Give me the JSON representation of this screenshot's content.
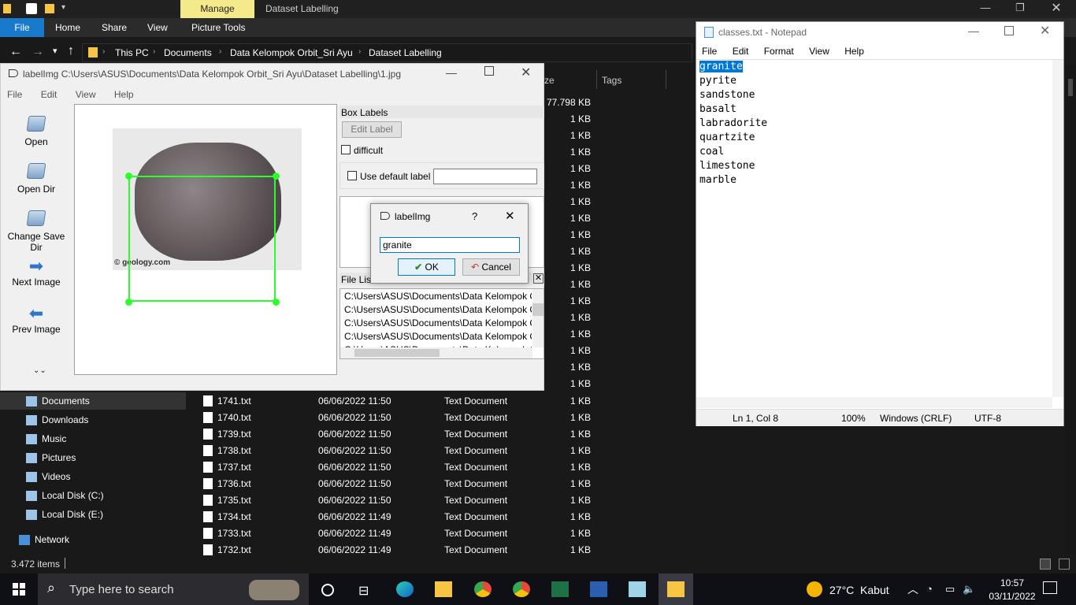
{
  "explorer": {
    "title": "Dataset Labelling",
    "manage_tab": "Manage",
    "ribbon_tabs": [
      "File",
      "Home",
      "Share",
      "View",
      "Picture Tools"
    ],
    "breadcrumb": [
      "This PC",
      "Documents",
      "Data Kelompok Orbit_Sri Ayu",
      "Dataset Labelling"
    ],
    "col_size_header": "ze",
    "col_tags_header": "Tags",
    "top_sizes": [
      "77.798 KB",
      "1 KB",
      "1 KB",
      "1 KB",
      "1 KB",
      "1 KB",
      "1 KB",
      "1 KB",
      "1 KB",
      "1 KB",
      "1 KB",
      "1 KB",
      "1 KB",
      "1 KB",
      "1 KB",
      "1 KB",
      "1 KB",
      "1 KB"
    ],
    "nav": [
      {
        "label": "Documents",
        "icon": "documents-icon"
      },
      {
        "label": "Downloads",
        "icon": "downloads-icon"
      },
      {
        "label": "Music",
        "icon": "music-icon"
      },
      {
        "label": "Pictures",
        "icon": "pictures-icon"
      },
      {
        "label": "Videos",
        "icon": "videos-icon"
      },
      {
        "label": "Local Disk (C:)",
        "icon": "disk-icon"
      },
      {
        "label": "Local Disk (E:)",
        "icon": "disk-icon"
      },
      {
        "label": "Network",
        "icon": "network-icon"
      }
    ],
    "files": [
      {
        "name": "1741.txt",
        "date": "06/06/2022 11:50",
        "type": "Text Document",
        "size": "1 KB"
      },
      {
        "name": "1740.txt",
        "date": "06/06/2022 11:50",
        "type": "Text Document",
        "size": "1 KB"
      },
      {
        "name": "1739.txt",
        "date": "06/06/2022 11:50",
        "type": "Text Document",
        "size": "1 KB"
      },
      {
        "name": "1738.txt",
        "date": "06/06/2022 11:50",
        "type": "Text Document",
        "size": "1 KB"
      },
      {
        "name": "1737.txt",
        "date": "06/06/2022 11:50",
        "type": "Text Document",
        "size": "1 KB"
      },
      {
        "name": "1736.txt",
        "date": "06/06/2022 11:50",
        "type": "Text Document",
        "size": "1 KB"
      },
      {
        "name": "1735.txt",
        "date": "06/06/2022 11:50",
        "type": "Text Document",
        "size": "1 KB"
      },
      {
        "name": "1734.txt",
        "date": "06/06/2022 11:49",
        "type": "Text Document",
        "size": "1 KB"
      },
      {
        "name": "1733.txt",
        "date": "06/06/2022 11:49",
        "type": "Text Document",
        "size": "1 KB"
      },
      {
        "name": "1732.txt",
        "date": "06/06/2022 11:49",
        "type": "Text Document",
        "size": "1 KB"
      }
    ],
    "status": "3.472 items"
  },
  "labelimg": {
    "title": "labelImg C:\\Users\\ASUS\\Documents\\Data Kelompok Orbit_Sri Ayu\\Dataset Labelling\\1.jpg",
    "menu": [
      "File",
      "Edit",
      "View",
      "Help"
    ],
    "tools": [
      "Open",
      "Open Dir",
      "Change Save Dir",
      "Next Image",
      "Prev Image"
    ],
    "watermark": "© geology.com",
    "box_labels_title": "Box Labels",
    "edit_label": "Edit Label",
    "difficult": "difficult",
    "use_default_label": "Use default label",
    "file_list_title": "File List",
    "file_list": [
      "C:\\Users\\ASUS\\Documents\\Data Kelompok C",
      "C:\\Users\\ASUS\\Documents\\Data Kelompok C",
      "C:\\Users\\ASUS\\Documents\\Data Kelompok C",
      "C:\\Users\\ASUS\\Documents\\Data Kelompok C",
      "C:\\Users\\ASUS\\Documents\\Data Kelompok C"
    ]
  },
  "dialog": {
    "title": "labelImg",
    "help": "?",
    "input_value": "granite",
    "ok": "OK",
    "cancel": "Cancel"
  },
  "notepad": {
    "title": "classes.txt - Notepad",
    "menu": [
      "File",
      "Edit",
      "Format",
      "View",
      "Help"
    ],
    "lines": [
      "granite",
      "pyrite",
      "sandstone",
      "basalt",
      "labradorite",
      "quartzite",
      "coal",
      "limestone",
      "marble"
    ],
    "status_pos": "Ln 1, Col 8",
    "status_zoom": "100%",
    "status_eol": "Windows (CRLF)",
    "status_enc": "UTF-8"
  },
  "taskbar": {
    "search_placeholder": "Type here to search",
    "weather": "27°C  Kabut",
    "time": "10:57",
    "date": "03/11/2022"
  },
  "colors": {
    "selection": "#0078d7",
    "bbox": "#2bff2b",
    "manage": "#f4e98b",
    "file_tab": "#1979ca"
  }
}
